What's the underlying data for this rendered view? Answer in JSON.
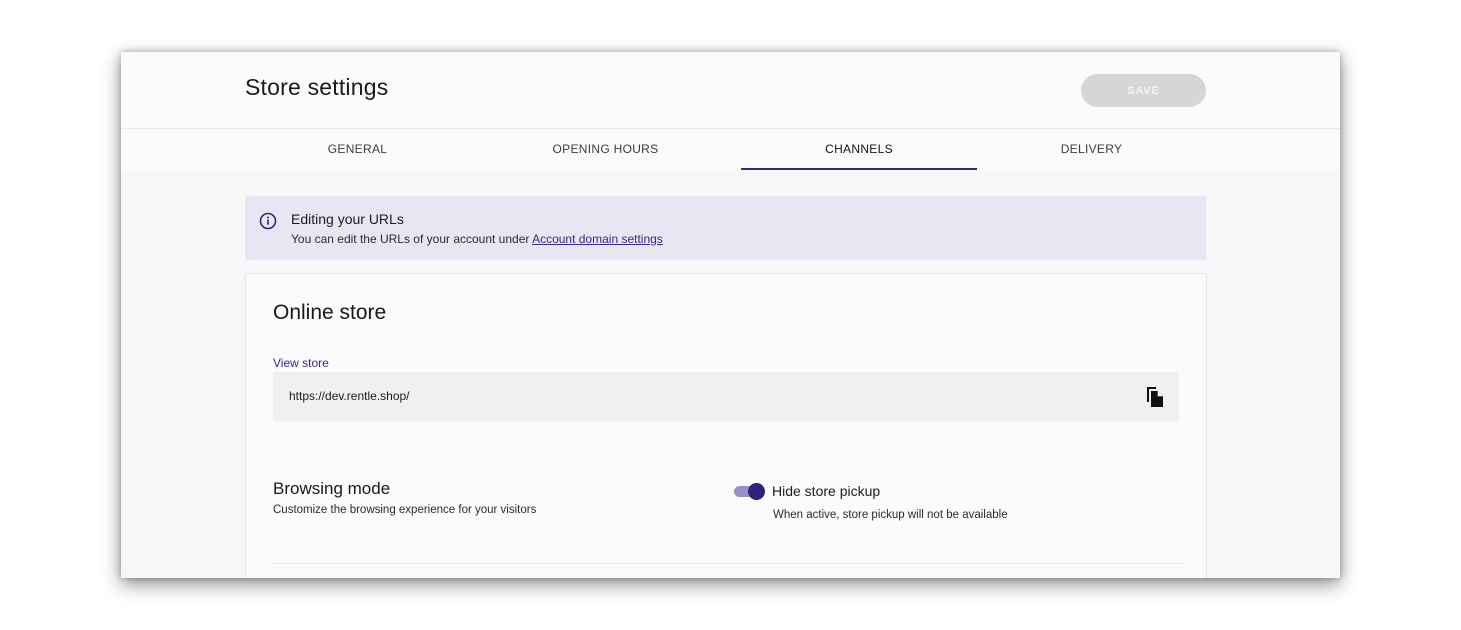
{
  "header": {
    "title": "Store settings",
    "save_label": "SAVE"
  },
  "tabs": [
    {
      "label": "GENERAL",
      "active": false
    },
    {
      "label": "OPENING HOURS",
      "active": false
    },
    {
      "label": "CHANNELS",
      "active": true
    },
    {
      "label": "DELIVERY",
      "active": false
    }
  ],
  "info_banner": {
    "icon": "info-icon",
    "title": "Editing your URLs",
    "text": "You can edit the URLs of your account under ",
    "link_label": "Account domain settings"
  },
  "online_store": {
    "title": "Online store",
    "view_store_label": "View store",
    "url": "https://dev.rentle.shop/",
    "copy_icon": "copy-icon"
  },
  "browsing_mode": {
    "title": "Browsing mode",
    "subtitle": "Customize the browsing experience for your visitors",
    "toggle_label": "Hide store pickup",
    "toggle_description": "When active, store pickup will not be available",
    "toggle_on": true
  },
  "colors": {
    "accent": "#33217a",
    "link": "#3b2784",
    "banner_bg": "#e9e5f3",
    "save_disabled": "#d6d5d8"
  }
}
